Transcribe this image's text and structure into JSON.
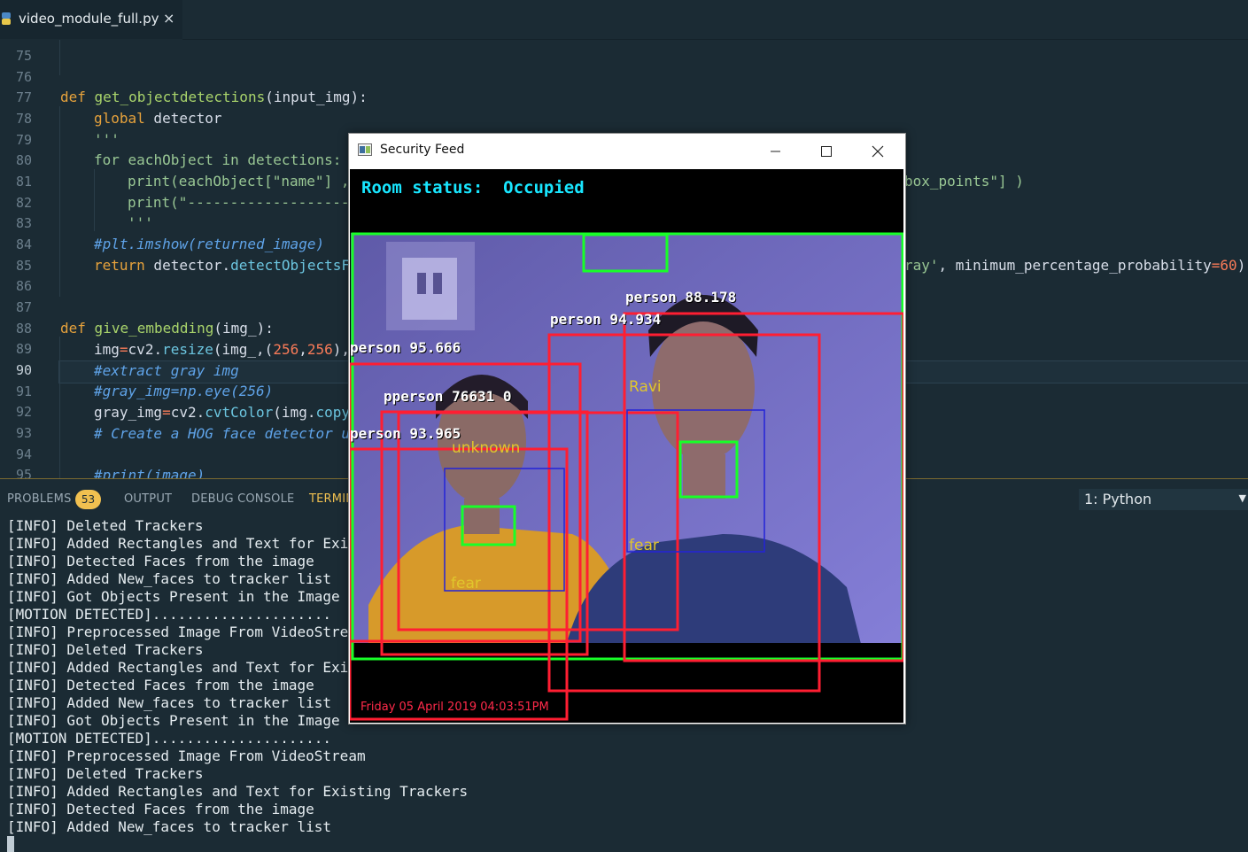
{
  "editor": {
    "tab_title": "video_module_full.py",
    "tab_close": "×",
    "line_numbers": [
      "75",
      "76",
      "77",
      "78",
      "79",
      "80",
      "81",
      "82",
      "83",
      "84",
      "85",
      "86",
      "87",
      "88",
      "89",
      "90",
      "91",
      "92",
      "93",
      "94",
      "95"
    ],
    "current_line": "90",
    "code": {
      "l77_kw": "def",
      "l77_fn": "get_objectdetections",
      "l77_rest": "(input_img):",
      "l78_kw": "global",
      "l78_rest": " detector",
      "l79": "'''",
      "l80_kw": "for",
      "l80_mid": " eachObject ",
      "l80_kw2": "in",
      "l80_rest": " detections:",
      "l81_a": "print",
      "l81_b": "(eachObject[",
      "l81_s": "\"name\"",
      "l81_c": "] ,",
      "l81_tail": "box_points\"] )",
      "l82_a": "print",
      "l82_s": "(\"-------------------",
      "l83": "'''",
      "l84": "#plt.imshow(returned_image)",
      "l85_kw": "return",
      "l85_mid": " detector.",
      "l85_fn": "detectObjectsF",
      "l85_tail_s": "ray'",
      "l85_tail_b": ", minimum_percentage_probability",
      "l85_tail_eq": "=",
      "l85_tail_n": "60",
      "l85_tail_c": ")",
      "l88_kw": "def",
      "l88_fn": "give_embedding",
      "l88_rest": "(img_):",
      "l89_a": "img",
      "l89_eq": "=",
      "l89_b": "cv2.",
      "l89_fn": "resize",
      "l89_c": "(img_,(",
      "l89_n1": "256",
      "l89_d": ",",
      "l89_n2": "256",
      "l89_e": "),",
      "l90": "#extract gray img",
      "l91": "#gray_img=np.eye(256)",
      "l92_a": "gray_img",
      "l92_eq": "=",
      "l92_b": "cv2.",
      "l92_fn": "cvtColor",
      "l92_c": "(img.",
      "l92_fn2": "copy",
      "l93": "# Create a HOG face detector u",
      "l95": "#print(image)"
    }
  },
  "panel": {
    "tabs": [
      "PROBLEMS",
      "OUTPUT",
      "DEBUG CONSOLE",
      "TERMIN"
    ],
    "problems_count": "53",
    "terminal_select": "1: Python",
    "terminal_lines": [
      "[INFO] Deleted Trackers",
      "[INFO] Added Rectangles and Text for Existi",
      "[INFO] Detected Faces from the image",
      "[INFO] Added New_faces to tracker list",
      "[INFO] Got Objects Present in the Image",
      "[MOTION DETECTED].....................",
      "[INFO] Preprocessed Image From VideoStream",
      "[INFO] Deleted Trackers",
      "[INFO] Added Rectangles and Text for Existi",
      "[INFO] Detected Faces from the image",
      "[INFO] Added New_faces to tracker list",
      "[INFO] Got Objects Present in the Image",
      "[MOTION DETECTED].....................",
      "[INFO] Preprocessed Image From VideoStream",
      "[INFO] Deleted Trackers",
      "[INFO] Added Rectangles and Text for Existing Trackers",
      "[INFO] Detected Faces from the image",
      "[INFO] Added New_faces to tracker list"
    ]
  },
  "window": {
    "title": "Security Feed",
    "status_label": "Room status:",
    "status_value": "Occupied",
    "timestamp": "Friday 05 April 2019 04:03:51PM",
    "detections": [
      {
        "label": "person 88.178"
      },
      {
        "label": "person 94.934"
      },
      {
        "label": "person 95.666"
      },
      {
        "label": "pperson 76631 0"
      },
      {
        "label": "person 93.965"
      }
    ],
    "faces": [
      {
        "name": "Ravi",
        "emotion": "fear"
      },
      {
        "name": "unknown",
        "emotion": "fear"
      }
    ]
  },
  "colors": {
    "status_text": "#18e6ff",
    "box_red": "#ff1e32",
    "box_green": "#18ff28",
    "box_blue": "#2323d8",
    "face_text": "#e0c62c",
    "timestamp": "#ff2a4a",
    "accent": "#f0c050"
  },
  "icons": [
    "python-file-icon",
    "close-icon",
    "window-app-icon",
    "minimize-icon",
    "maximize-icon",
    "window-close-icon",
    "chevron-down-icon"
  ]
}
